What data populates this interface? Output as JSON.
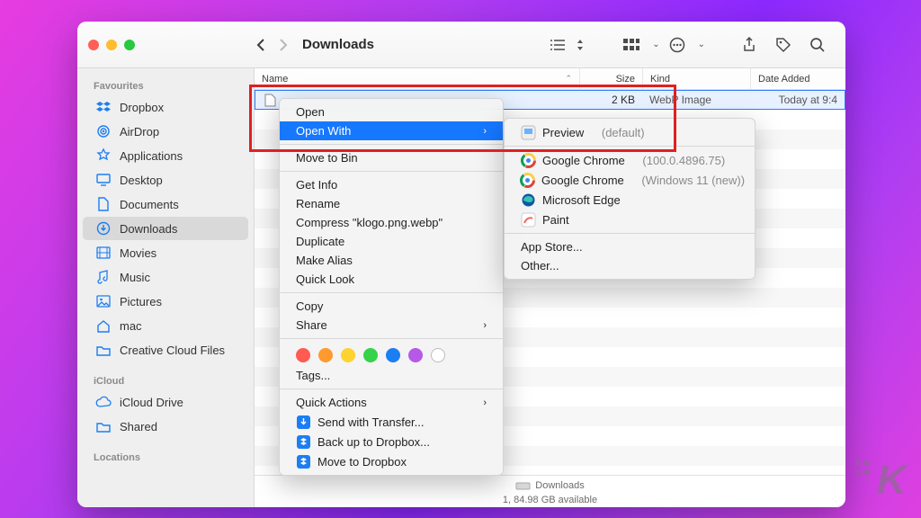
{
  "toolbar": {
    "title": "Downloads"
  },
  "sidebar": {
    "groups": [
      {
        "label": "Favourites",
        "items": [
          {
            "icon": "dropbox",
            "label": "Dropbox"
          },
          {
            "icon": "airdrop",
            "label": "AirDrop"
          },
          {
            "icon": "apps",
            "label": "Applications"
          },
          {
            "icon": "desktop",
            "label": "Desktop"
          },
          {
            "icon": "doc",
            "label": "Documents"
          },
          {
            "icon": "download",
            "label": "Downloads",
            "selected": true
          },
          {
            "icon": "movie",
            "label": "Movies"
          },
          {
            "icon": "music",
            "label": "Music"
          },
          {
            "icon": "picture",
            "label": "Pictures"
          },
          {
            "icon": "home",
            "label": "mac"
          },
          {
            "icon": "folder",
            "label": "Creative Cloud Files"
          }
        ]
      },
      {
        "label": "iCloud",
        "items": [
          {
            "icon": "icloud",
            "label": "iCloud Drive"
          },
          {
            "icon": "shared",
            "label": "Shared"
          }
        ]
      },
      {
        "label": "Locations",
        "items": []
      }
    ]
  },
  "columns": {
    "name": "Name",
    "size": "Size",
    "kind": "Kind",
    "date": "Date Added"
  },
  "row": {
    "size": "2 KB",
    "kind": "WebP Image",
    "date": "Today at 9:4"
  },
  "status": {
    "line1": "Downloads",
    "line2": "1, 84.98 GB available"
  },
  "menu1": {
    "open": "Open",
    "openwith": "Open With",
    "movetobin": "Move to Bin",
    "getinfo": "Get Info",
    "rename": "Rename",
    "compress": "Compress \"klogo.png.webp\"",
    "duplicate": "Duplicate",
    "makealias": "Make Alias",
    "quicklook": "Quick Look",
    "copy": "Copy",
    "share": "Share",
    "tags": "Tags...",
    "quickactions": "Quick Actions",
    "sendtransfer": "Send with Transfer...",
    "backupdropbox": "Back up to Dropbox...",
    "movedropbox": "Move to Dropbox"
  },
  "menu2": {
    "preview": "Preview",
    "preview_suffix": "(default)",
    "chrome1": "Google Chrome",
    "chrome1_suffix": "(100.0.4896.75)",
    "chrome2": "Google Chrome",
    "chrome2_suffix": "(Windows 11 (new))",
    "edge": "Microsoft Edge",
    "paint": "Paint",
    "appstore": "App Store...",
    "other": "Other..."
  },
  "tag_colors": [
    "#ff5b51",
    "#ff9a2e",
    "#ffd32e",
    "#36d24b",
    "#1c7ef3",
    "#b659e8",
    "#00000000"
  ]
}
